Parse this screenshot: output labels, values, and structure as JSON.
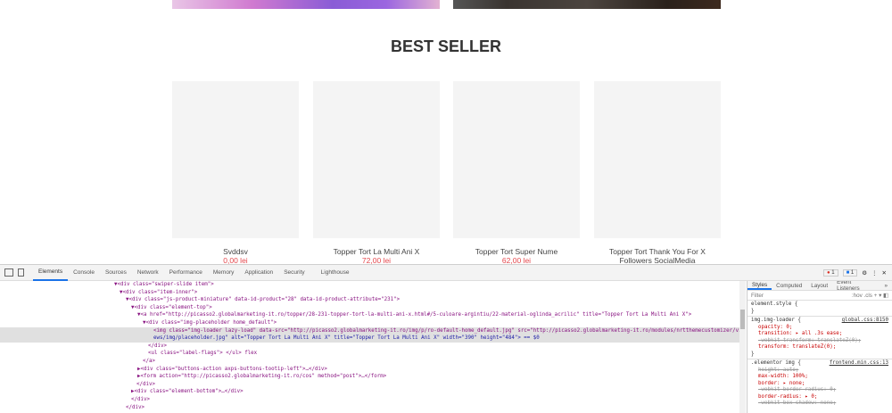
{
  "page": {
    "section_title": "BEST SELLER",
    "products": [
      {
        "name": "Svddsv",
        "price": "0,00 lei"
      },
      {
        "name": "Topper Tort La Multi Ani X",
        "price": "72,00 lei"
      },
      {
        "name": "Topper Tort Super Nume",
        "price": "62,00 lei"
      },
      {
        "name": "Topper Tort Thank You For X Followers SocialMedia",
        "price": ""
      }
    ]
  },
  "devtools": {
    "tabs": [
      "Elements",
      "Console",
      "Sources",
      "Network",
      "Performance",
      "Memory",
      "Application",
      "Security",
      "Lighthouse"
    ],
    "errors": "1",
    "messages": "1",
    "styles_tabs": [
      "Styles",
      "Computed",
      "Layout",
      "Event Listeners",
      "»"
    ],
    "filter_placeholder": "Filter",
    "hov": ":hov",
    ".cls": ".cls",
    "dom_lines": [
      "▼<div class=\"swiper-slide item\">",
      "▼<div class=\"item-inner\">",
      "▼<div class=\"js-product-miniature\" data-id-product=\"28\" data-id-product-attribute=\"231\">",
      "▼<div class=\"element-top\">",
      "▼<a href=\"http://picasso2.globalmarketing-it.ro/topper/28-231-topper-tort-la-multi-ani-x.html#/5-culoare-argintiu/22-material-oglinda_acrilic\" title=\"Topper Tort La Multi Ani X\">",
      "▼<div class=\"img-placeholder home_default\">",
      "<img class=\"img-loader lazy-load\" data-src=\"http://picasso2.globalmarketing-it.ro/img/p/ro-default-home_default.jpg\" src=\"http://picasso2.globalmarketing-it.ro/modules/nrtthemecustomizer/vi",
      "ews/img/placeholder.jpg\" alt=\"Topper Tort La Multi Ani X\" title=\"Topper Tort La Multi Ani X\" width=\"390\" height=\"484\"> == $0",
      "</div>",
      "<ul class=\"label-flags\"> </ul> flex",
      "</a>",
      "▶<div class=\"buttons-action axps-buttons-tootip-left\">…</div>",
      "▶<form action=\"http://picasso2.globalmarketing-it.ro/cos\" method=\"post\">…</form>",
      "</div>",
      "▶<div class=\"element-bottom\">…</div>",
      "</div>",
      "</div>"
    ],
    "rules": [
      {
        "selector": "element.style {",
        "source": "",
        "props": []
      },
      {
        "selector": "img.img-loader {",
        "source": "global.css:8150",
        "props": [
          "opacity: 0;",
          "transition: ▸ all .3s ease;",
          "-webkit-transform: translateZ(0);",
          "transform: translateZ(0);"
        ]
      },
      {
        "selector": ".elementor img {",
        "source": "frontend.min.css:13",
        "props": [
          "height: auto;",
          "max-width: 100%;",
          "border: ▸ none;",
          "-webkit-border-radius: 0;",
          "border-radius: ▸ 0;",
          "-webkit-box-shadow: none;"
        ]
      }
    ]
  }
}
